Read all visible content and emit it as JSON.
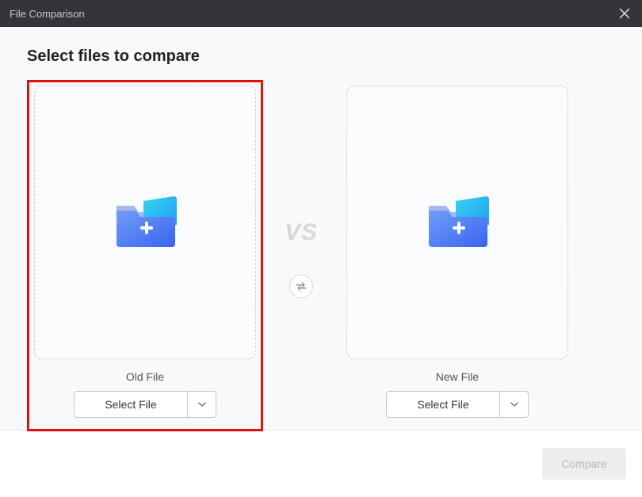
{
  "window": {
    "title": "File Comparison"
  },
  "heading": "Select files to compare",
  "mid": {
    "vs_label": "VS"
  },
  "panels": {
    "left": {
      "label": "Old File",
      "select_label": "Select File"
    },
    "right": {
      "label": "New File",
      "select_label": "Select File"
    }
  },
  "footer": {
    "compare_label": "Compare"
  }
}
